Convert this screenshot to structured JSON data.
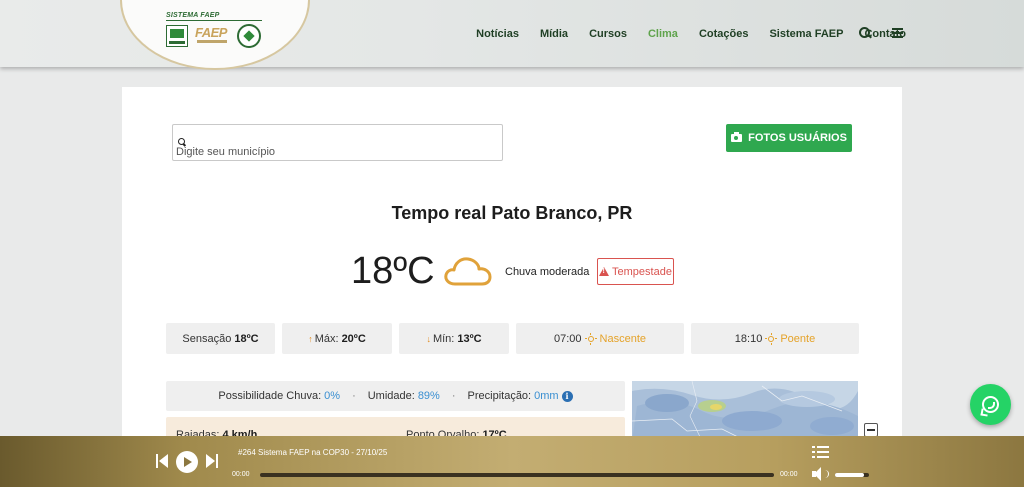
{
  "header": {
    "logo_caption": "SISTEMA FAEP",
    "logo_faep": "FAEP",
    "nav": [
      {
        "label": "Notícias",
        "active": false
      },
      {
        "label": "Mídia",
        "active": false
      },
      {
        "label": "Cursos",
        "active": false
      },
      {
        "label": "Clima",
        "active": true
      },
      {
        "label": "Cotações",
        "active": false
      },
      {
        "label": "Sistema FAEP",
        "active": false
      },
      {
        "label": "Contato",
        "active": false
      }
    ],
    "icons": {
      "search": "search-icon",
      "menu": "hamburger-menu-icon"
    }
  },
  "search": {
    "placeholder": "Digite seu município",
    "value": ""
  },
  "photos_button": {
    "label": "FOTOS USUÁRIOS",
    "icon": "camera-icon"
  },
  "weather": {
    "title": "Tempo real Pato Branco, PR",
    "temperature": "18ºC",
    "condition": "Chuva moderada",
    "condition_icon": "cloud-icon",
    "alert": "Tempestade",
    "alert_icon": "warning-icon"
  },
  "stats": {
    "feels_label": "Sensação",
    "feels_value": "18ºC",
    "max_label": "Máx:",
    "max_value": "20ºC",
    "min_label": "Mín:",
    "min_value": "13ºC",
    "sunrise_time": "07:00",
    "sunrise_label": "Nascente",
    "sunset_time": "18:10",
    "sunset_label": "Poente"
  },
  "details": {
    "rain_label": "Possibilidade Chuva:",
    "rain_value": "0%",
    "humidity_label": "Umidade:",
    "humidity_value": "89%",
    "precip_label": "Precipitação:",
    "precip_value": "0mm",
    "separator": "·",
    "info_glyph": "i",
    "gusts_label": "Rajadas:",
    "gusts_value": "4 km/h",
    "dew_label": "Ponto Orvalho:",
    "dew_value": "17ºC"
  },
  "player": {
    "track_title": "#264 Sistema FAEP na COP30 - 27/10/25",
    "time_current": "00:00",
    "time_total": "00:00",
    "progress": 0,
    "volume": 0.85,
    "colors": {
      "accent": "#c3ad72",
      "track": "#3a3120"
    }
  },
  "colors": {
    "green_button": "#2fa84f",
    "alert_red": "#d9534f",
    "sun_orange": "#e5a32a",
    "value_blue": "#3a8fd1",
    "nav_active": "#5fa34c",
    "whatsapp": "#25d366"
  }
}
